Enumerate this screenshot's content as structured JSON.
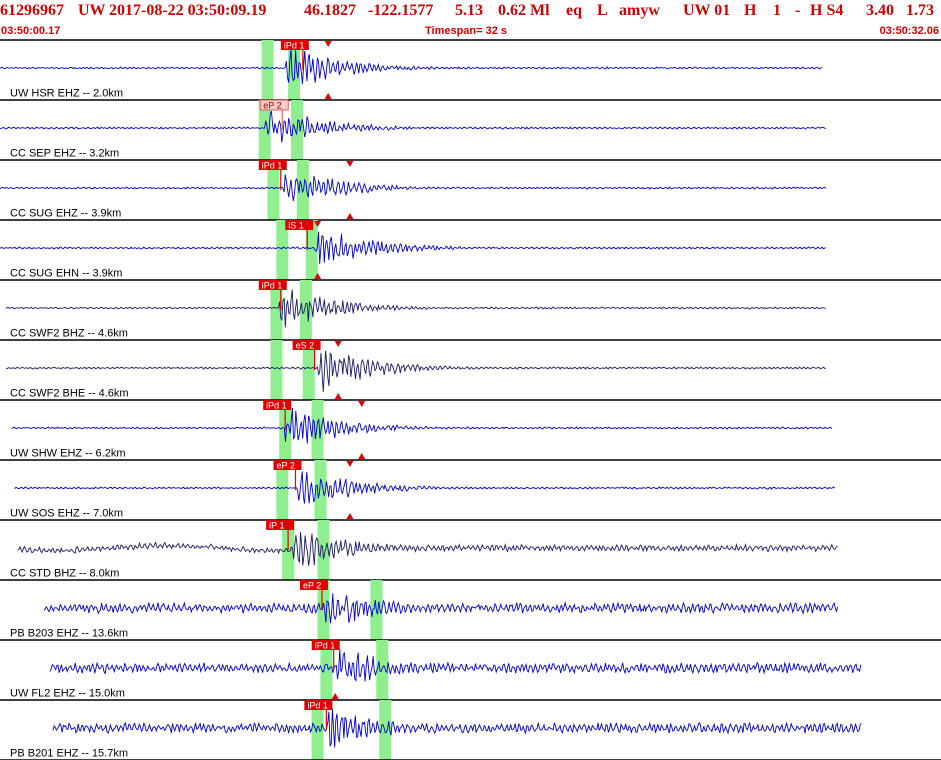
{
  "header": {
    "event_id": "61296967",
    "network": "UW",
    "origin_time": "2017-08-22 03:50:09.19",
    "latitude": "46.1827",
    "longitude": "-122.1577",
    "depth": "5.13",
    "magnitude": "0.62 Ml",
    "event_type": "eq",
    "location_flag": "L",
    "analyst": "amyw",
    "source": "UW 01",
    "quality": "H",
    "version": "1",
    "dash": "-",
    "review": "H S4",
    "value_a": "3.40",
    "value_b": "1.73"
  },
  "timebar": {
    "start": "03:50:00.17",
    "timespan": "Timespan=  32 s",
    "end": "03:50:32.06"
  },
  "colors": {
    "trace_primary": "#0000cc",
    "trace_dark": "#1a1a66",
    "header_text": "#cc0000",
    "pick_fill": "#dd0000",
    "pick_light": "#ffcccc",
    "window": "#8fef8f",
    "separator": "#000000"
  },
  "chart_data": {
    "type": "line",
    "title": "",
    "timespan_s": 32,
    "channels": [
      {
        "label": "UW HSR EHZ -- 2.0km",
        "picks": [
          {
            "label": "iPd 1",
            "t": 9.55,
            "style": "solid"
          }
        ],
        "s_marker_t": 11.16,
        "green_windows": [
          9.1,
          10.0
        ],
        "onset_t": 9.7,
        "trace_start_t": 0.0,
        "trace_end_t": 28.0,
        "color": "#0000cc"
      },
      {
        "label": "CC SEP EHZ -- 3.2km",
        "picks": [
          {
            "label": "eP 2",
            "t": 8.85,
            "style": "light"
          }
        ],
        "s_marker_t": null,
        "green_windows": [
          9.0,
          10.1
        ],
        "onset_t": 9.0,
        "trace_start_t": 0.0,
        "trace_end_t": 28.1,
        "color": "#0000cc"
      },
      {
        "label": "CC SUG EHZ -- 3.9km",
        "picks": [
          {
            "label": "iPd 1",
            "t": 8.8,
            "style": "solid"
          }
        ],
        "s_marker_t": 11.9,
        "green_windows": [
          9.3,
          10.3
        ],
        "onset_t": 9.6,
        "trace_start_t": 0.0,
        "trace_end_t": 28.1,
        "color": "#0000cc"
      },
      {
        "label": "CC SUG EHN -- 3.9km",
        "picks": [
          {
            "label": "iS 1",
            "t": 9.7,
            "style": "solid"
          }
        ],
        "s_marker_t": 10.8,
        "green_windows": [
          9.6,
          10.6
        ],
        "onset_t": 10.7,
        "trace_start_t": 0.0,
        "trace_end_t": 28.1,
        "color": "#0000cc"
      },
      {
        "label": "CC SWF2 BHZ -- 4.6km",
        "picks": [
          {
            "label": "iPd 1",
            "t": 8.8,
            "style": "solid"
          }
        ],
        "s_marker_t": null,
        "green_windows": [
          9.4,
          10.4
        ],
        "onset_t": 9.5,
        "trace_start_t": 0.2,
        "trace_end_t": 28.1,
        "color": "#1a1a66"
      },
      {
        "label": "CC SWF2 BHE -- 4.6km",
        "picks": [
          {
            "label": "eS 2",
            "t": 9.95,
            "style": "solid"
          }
        ],
        "s_marker_t": 11.5,
        "green_windows": [
          9.4,
          10.5
        ],
        "onset_t": 10.8,
        "trace_start_t": 0.2,
        "trace_end_t": 28.1,
        "color": "#1a1a66"
      },
      {
        "label": "UW SHW EHZ -- 6.2km",
        "picks": [
          {
            "label": "iPd 1",
            "t": 8.95,
            "style": "solid"
          }
        ],
        "s_marker_t": 12.3,
        "green_windows": [
          9.7,
          10.8
        ],
        "onset_t": 9.7,
        "trace_start_t": 0.4,
        "trace_end_t": 28.3,
        "color": "#0000cc"
      },
      {
        "label": "UW SOS EHZ -- 7.0km",
        "picks": [
          {
            "label": "eP 2",
            "t": 9.3,
            "style": "solid"
          }
        ],
        "s_marker_t": 11.9,
        "green_windows": [
          9.6,
          10.9
        ],
        "onset_t": 10.1,
        "trace_start_t": 0.5,
        "trace_end_t": 28.4,
        "color": "#0000cc"
      },
      {
        "label": "CC STD BHZ -- 8.0km",
        "picks": [
          {
            "label": "iP 1",
            "t": 9.05,
            "style": "solid"
          }
        ],
        "s_marker_t": null,
        "green_windows": [
          9.8,
          11.0
        ],
        "onset_t": 9.95,
        "trace_start_t": 0.6,
        "trace_end_t": 28.5,
        "color": "#1a1a66"
      },
      {
        "label": "PB B203 EHZ -- 13.6km",
        "picks": [
          {
            "label": "eP 2",
            "t": 10.2,
            "style": "solid"
          }
        ],
        "s_marker_t": null,
        "green_windows": [
          11.0,
          12.8
        ],
        "onset_t": 11.0,
        "trace_start_t": 1.5,
        "trace_end_t": 28.5,
        "color": "#0000cc"
      },
      {
        "label": "UW FL2 EHZ -- 15.0km",
        "picks": [
          {
            "label": "iPd 1",
            "t": 10.6,
            "style": "solid"
          }
        ],
        "s_marker_t": 11.4,
        "green_windows": [
          11.1,
          13.0
        ],
        "onset_t": 11.3,
        "trace_start_t": 1.7,
        "trace_end_t": 29.3,
        "color": "#0000cc"
      },
      {
        "label": "PB B201 EHZ -- 15.7km",
        "picks": [
          {
            "label": "iPd 1",
            "t": 10.35,
            "style": "solid"
          }
        ],
        "s_marker_t": null,
        "green_windows": [
          10.8,
          13.1
        ],
        "onset_t": 11.1,
        "trace_start_t": 1.8,
        "trace_end_t": 29.3,
        "color": "#0000cc"
      }
    ]
  }
}
